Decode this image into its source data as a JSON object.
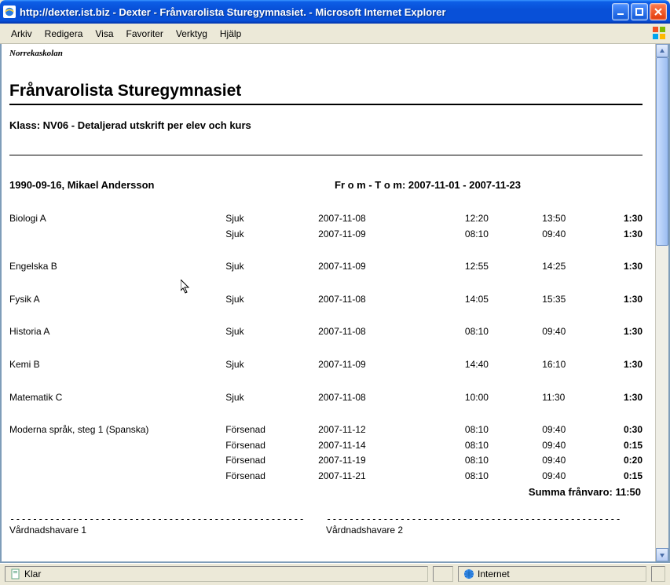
{
  "window": {
    "title": "http://dexter.ist.biz - Dexter - Frånvarolista Sturegymnasiet. - Microsoft Internet Explorer"
  },
  "menu": {
    "items": [
      "Arkiv",
      "Redigera",
      "Visa",
      "Favoriter",
      "Verktyg",
      "Hjälp"
    ]
  },
  "page": {
    "school": "Norrekaskolan",
    "title": "Frånvarolista Sturegymnasiet",
    "class_line": "Klass: NV06 - Detaljerad utskrift per elev och kurs",
    "student": "1990-09-16, Mikael Andersson",
    "period_label": "Fr o m - T o m: 2007-11-01 - 2007-11-23",
    "rows": [
      {
        "course": "Biologi A",
        "reason": "Sjuk",
        "date": "2007-11-08",
        "start": "12:20",
        "end": "13:50",
        "dur": "1:30",
        "gap": false
      },
      {
        "course": "",
        "reason": "Sjuk",
        "date": "2007-11-09",
        "start": "08:10",
        "end": "09:40",
        "dur": "1:30",
        "gap": true
      },
      {
        "course": "Engelska B",
        "reason": "Sjuk",
        "date": "2007-11-09",
        "start": "12:55",
        "end": "14:25",
        "dur": "1:30",
        "gap": true
      },
      {
        "course": "Fysik A",
        "reason": "Sjuk",
        "date": "2007-11-08",
        "start": "14:05",
        "end": "15:35",
        "dur": "1:30",
        "gap": true
      },
      {
        "course": "Historia A",
        "reason": "Sjuk",
        "date": "2007-11-08",
        "start": "08:10",
        "end": "09:40",
        "dur": "1:30",
        "gap": true
      },
      {
        "course": "Kemi B",
        "reason": "Sjuk",
        "date": "2007-11-09",
        "start": "14:40",
        "end": "16:10",
        "dur": "1:30",
        "gap": true
      },
      {
        "course": "Matematik C",
        "reason": "Sjuk",
        "date": "2007-11-08",
        "start": "10:00",
        "end": "11:30",
        "dur": "1:30",
        "gap": true
      },
      {
        "course": "Moderna språk, steg 1 (Spanska)",
        "reason": "Försenad",
        "date": "2007-11-12",
        "start": "08:10",
        "end": "09:40",
        "dur": "0:30",
        "gap": false
      },
      {
        "course": "",
        "reason": "Försenad",
        "date": "2007-11-14",
        "start": "08:10",
        "end": "09:40",
        "dur": "0:15",
        "gap": false
      },
      {
        "course": "",
        "reason": "Försenad",
        "date": "2007-11-19",
        "start": "08:10",
        "end": "09:40",
        "dur": "0:20",
        "gap": false
      },
      {
        "course": "",
        "reason": "Försenad",
        "date": "2007-11-21",
        "start": "08:10",
        "end": "09:40",
        "dur": "0:15",
        "gap": false
      }
    ],
    "sum_line": "Summa frånvaro: 11:50",
    "guardian1": "Vårdnadshavare 1",
    "guardian2": "Vårdnadshavare 2",
    "dashes": "----------------------------------------------------"
  },
  "status": {
    "left": "Klar",
    "zone": "Internet"
  }
}
